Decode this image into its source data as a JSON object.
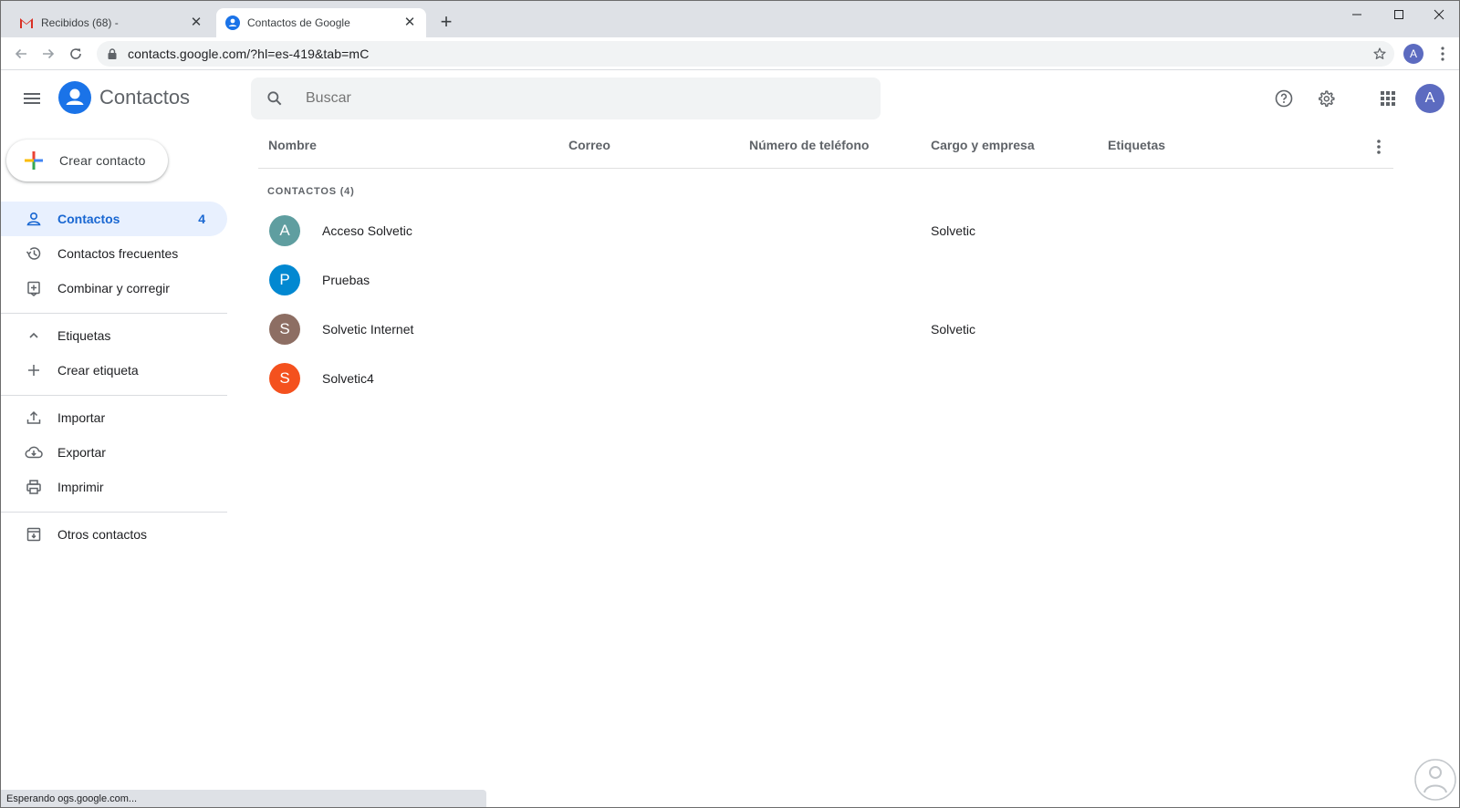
{
  "browser": {
    "tabs": [
      {
        "title": "Recibidos (68) - ",
        "active": false
      },
      {
        "title": "Contactos de Google",
        "active": true
      }
    ],
    "url": "contacts.google.com/?hl=es-419&tab=mC",
    "profile_initial": "A",
    "status_text": "Esperando ogs.google.com..."
  },
  "header": {
    "app_title": "Contactos",
    "search_placeholder": "Buscar",
    "avatar_initial": "A"
  },
  "sidebar": {
    "create_label": "Crear contacto",
    "items": [
      {
        "label": "Contactos",
        "count": "4",
        "icon": "person-icon",
        "selected": true
      },
      {
        "label": "Contactos frecuentes",
        "icon": "history-icon"
      },
      {
        "label": "Combinar y corregir",
        "icon": "merge-icon"
      },
      {
        "label": "Etiquetas",
        "icon": "chevron-up-icon"
      },
      {
        "label": "Crear etiqueta",
        "icon": "plus-icon"
      },
      {
        "label": "Importar",
        "icon": "upload-icon"
      },
      {
        "label": "Exportar",
        "icon": "cloud-download-icon"
      },
      {
        "label": "Imprimir",
        "icon": "printer-icon"
      },
      {
        "label": "Otros contactos",
        "icon": "archive-icon"
      }
    ]
  },
  "table": {
    "columns": [
      "Nombre",
      "Correo",
      "Número de teléfono",
      "Cargo y empresa",
      "Etiquetas"
    ],
    "group_label": "CONTACTOS (4)",
    "rows": [
      {
        "initial": "A",
        "name": "Acceso Solvetic",
        "company": "Solvetic",
        "color": "#5f9ea0"
      },
      {
        "initial": "P",
        "name": "Pruebas",
        "company": "",
        "color": "#0288d1"
      },
      {
        "initial": "S",
        "name": "Solvetic Internet",
        "company": "Solvetic",
        "color": "#8d6e63"
      },
      {
        "initial": "S",
        "name": "Solvetic4",
        "company": "",
        "color": "#f4511e"
      }
    ]
  }
}
